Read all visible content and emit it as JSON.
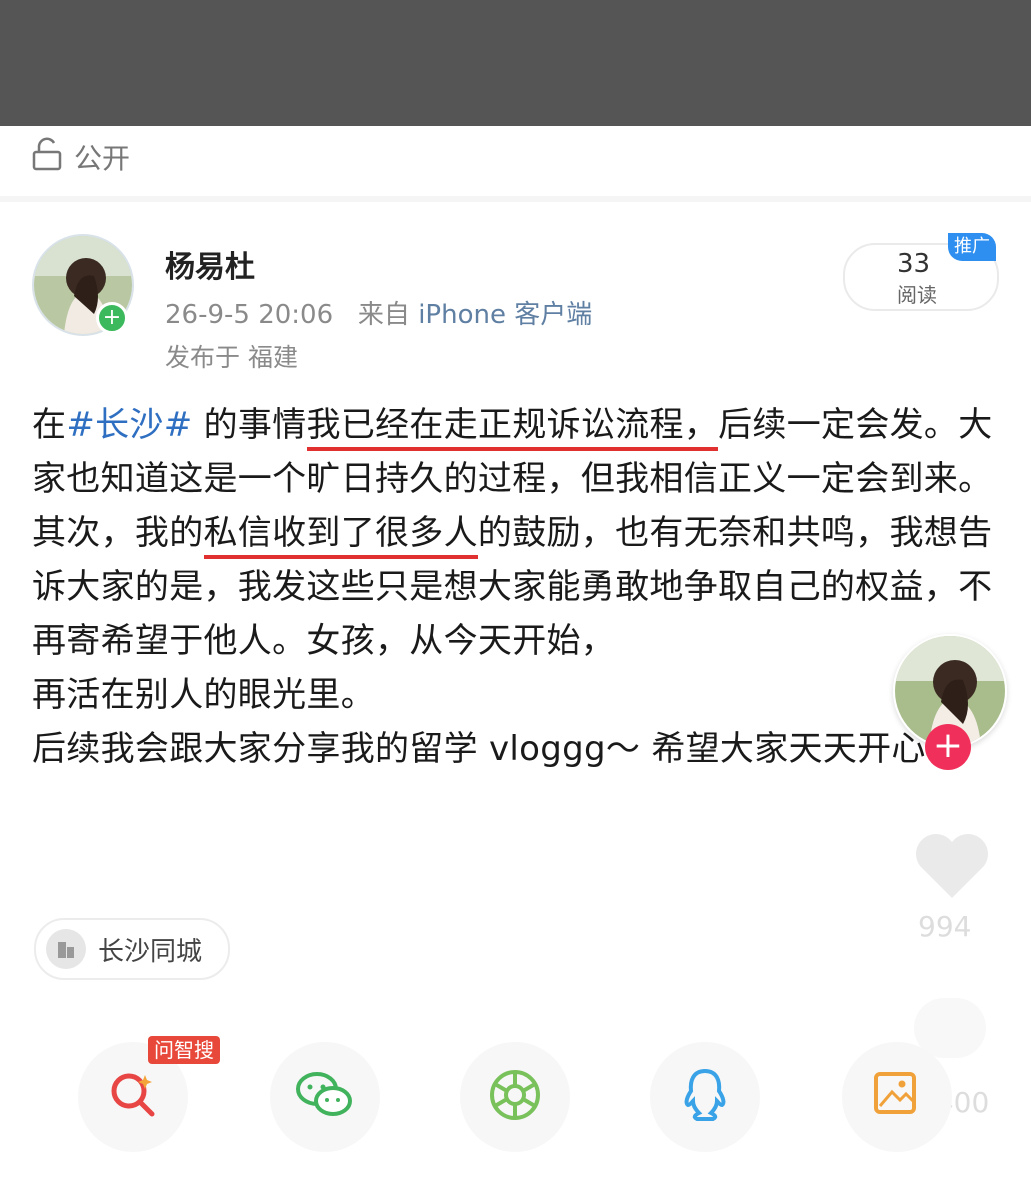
{
  "header": {
    "visibility_label": "公开",
    "visibility_icon": "unlock-icon"
  },
  "post": {
    "username": "杨易杜",
    "date": "26-9-5 20:06",
    "from_label": "来自",
    "client": "iPhone 客户端",
    "location": "发布于 福建",
    "read_count": "33",
    "read_label": "阅读",
    "promo_badge": "推广",
    "content": {
      "p1_before": "在",
      "p1_tag": "#长沙#",
      "p1_mid": " 的事情",
      "p1_underlined": "我已经在走正规诉讼流程，",
      "p1_after": "后续一定会发。大家也知道这是一个旷日持久的过程，但我相信正义一定会到来。",
      "p2_before": "其次，我的",
      "p2_underlined": "私信收到了很多人",
      "p2_after": "的鼓励，也有无奈和共鸣，我想告诉大家的是，我发这些只是想大家能勇敢地争取自己的权益，不再寄希望于他人。女孩，从今天开始，",
      "p2_tail": "再活在别人的眼光里。",
      "p3": "后续我会跟大家分享我的留学 vloggg～ 希望大家天天开心呀"
    },
    "topic_label": "长沙同城"
  },
  "side": {
    "like_count": "994",
    "share_count": "2400"
  },
  "share_bar": {
    "ai_badge": "问智搜",
    "buttons": [
      "search-ai-icon",
      "wechat-icon",
      "moments-icon",
      "qq-icon",
      "save-image-icon"
    ]
  },
  "colors": {
    "tag": "#2f6fc1",
    "underline": "#e03030",
    "follow": "#f0305a",
    "promo": "#2e8ff0"
  }
}
